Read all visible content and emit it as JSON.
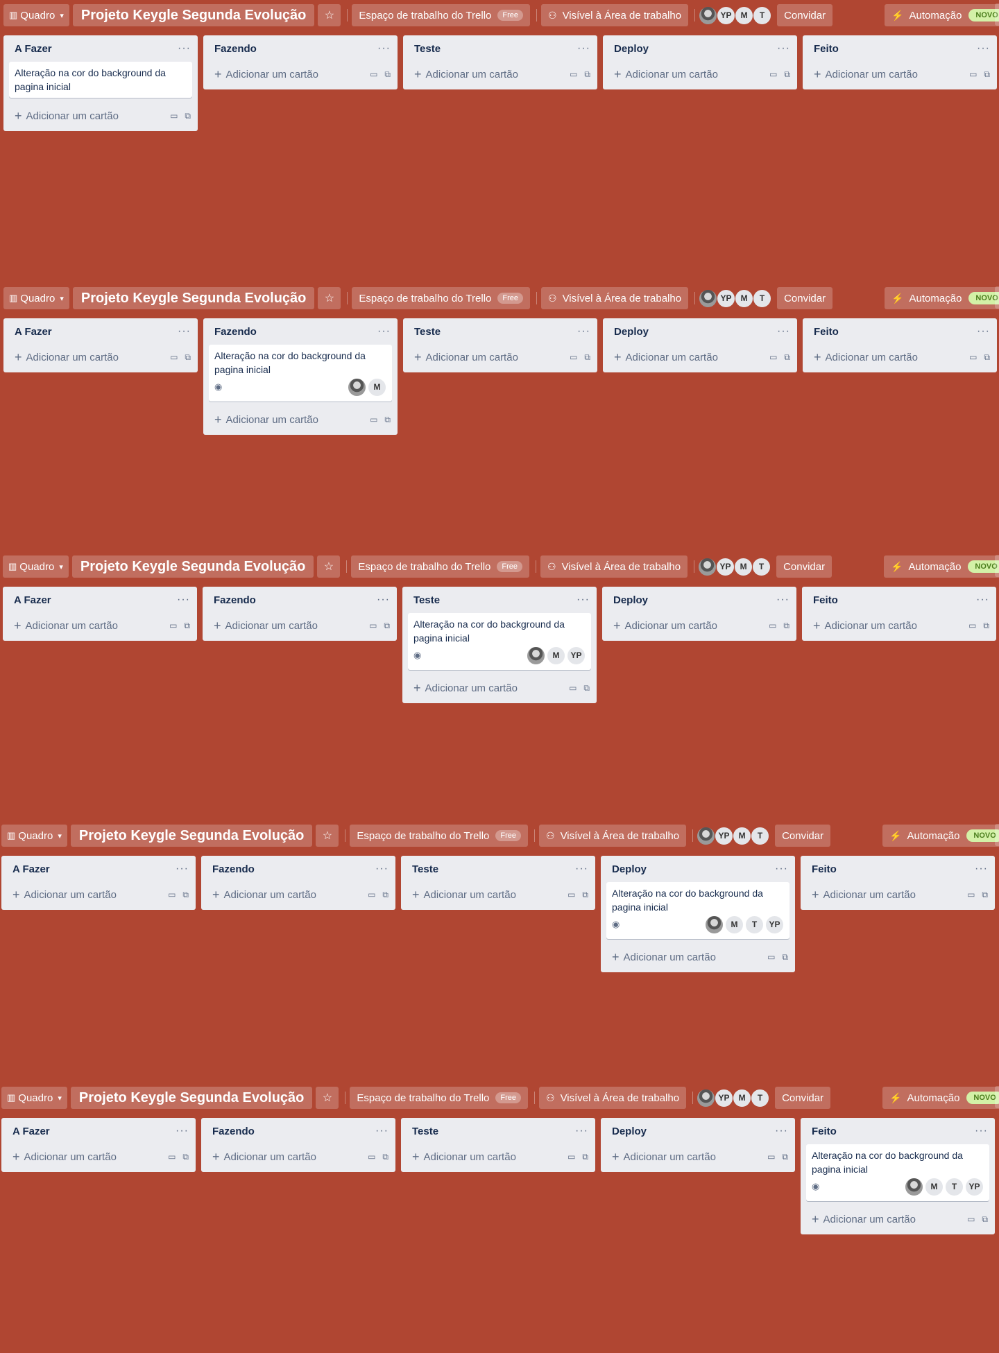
{
  "header": {
    "quadro_label": "Quadro",
    "board_title": "Projeto Keygle Segunda Evolução",
    "workspace_label": "Espaço de trabalho do Trello",
    "free_badge": "Free",
    "visibility_label": "Visível à Área de trabalho",
    "members": [
      "photo",
      "YP",
      "M",
      "T"
    ],
    "invite_label": "Convidar",
    "automation_label": "Automação",
    "novo_badge": "NOVO"
  },
  "lists": [
    "A Fazer",
    "Fazendo",
    "Teste",
    "Deploy",
    "Feito"
  ],
  "add_card_label": "Adicionar um cartão",
  "card_title": "Alteração na cor do background da pagina inicial",
  "panels": [
    {
      "card_list": 0,
      "card_members": []
    },
    {
      "card_list": 1,
      "card_members": [
        "photo",
        "M"
      ]
    },
    {
      "card_list": 2,
      "card_members": [
        "photo",
        "M",
        "YP"
      ]
    },
    {
      "card_list": 3,
      "card_members": [
        "photo",
        "M",
        "T",
        "YP"
      ]
    },
    {
      "card_list": 4,
      "card_members": [
        "photo",
        "M",
        "T",
        "YP"
      ]
    }
  ],
  "icons": {
    "quadro": "board-icon",
    "chevron": "chevron-down-icon",
    "star": "star-icon",
    "visibility": "people-icon",
    "automation": "bolt-icon",
    "menu": "more-icon",
    "plus": "plus-icon",
    "template": "template-icon",
    "eye": "eye-icon"
  },
  "colors": {
    "background": "#b04632",
    "list_bg": "#ebecf0",
    "novo_bg": "#d3f1a7"
  }
}
